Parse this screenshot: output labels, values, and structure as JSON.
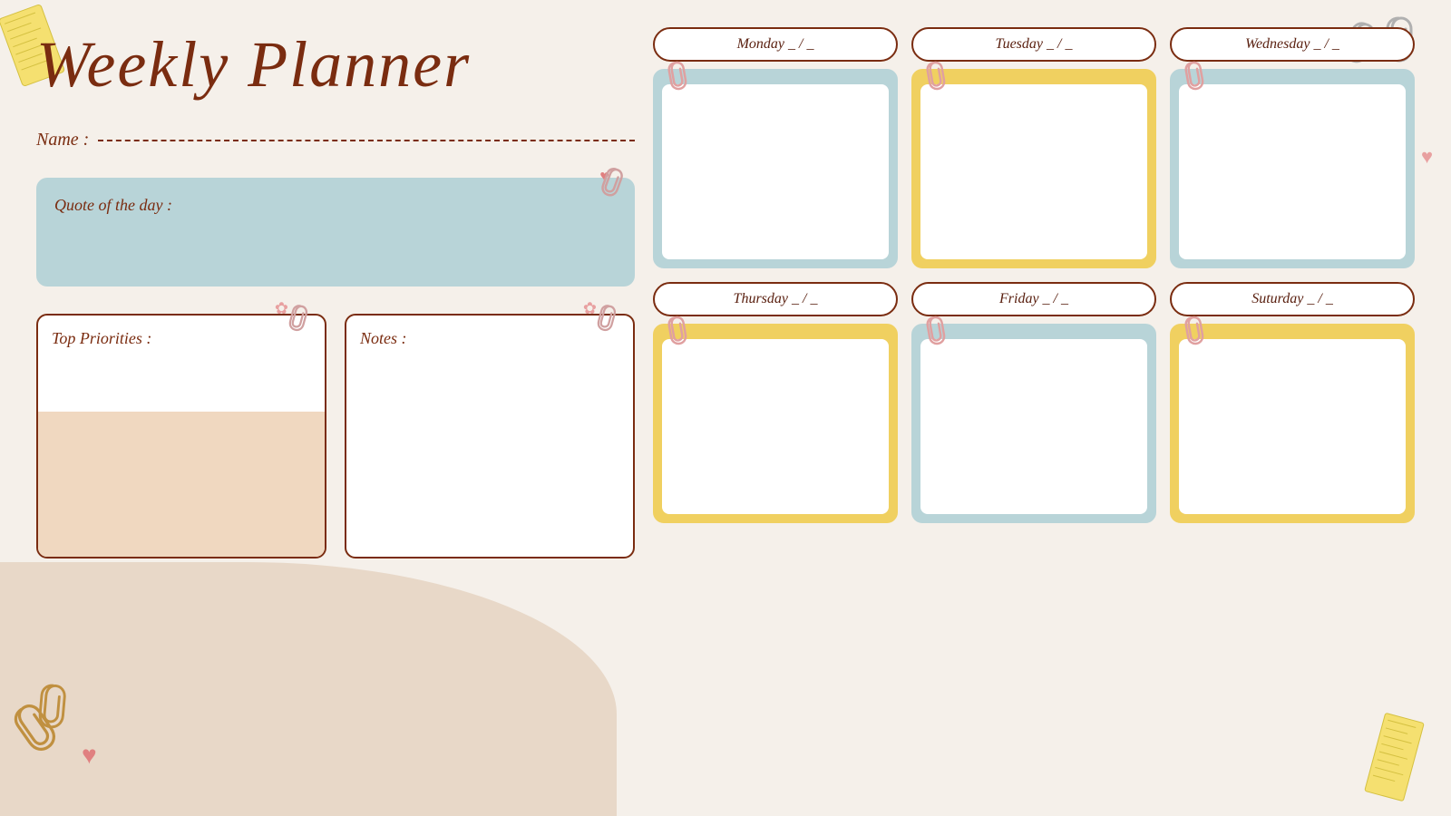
{
  "title": "Weekly Planner",
  "name_label": "Name :",
  "quote_label": "Quote of the day :",
  "priorities_label": "Top Priorities :",
  "notes_label": "Notes :",
  "days": [
    {
      "id": "monday",
      "label": "Monday _ / _",
      "color": "blue"
    },
    {
      "id": "tuesday",
      "label": "Tuesday _ / _",
      "color": "yellow"
    },
    {
      "id": "wednesday",
      "label": "Wednesday _ / _",
      "color": "blue"
    },
    {
      "id": "thursday",
      "label": "Thursday _ / _",
      "color": "yellow"
    },
    {
      "id": "friday",
      "label": "Friday _ / _",
      "color": "blue"
    },
    {
      "id": "saturday",
      "label": "Suturday _ / _",
      "color": "yellow"
    }
  ],
  "accent_color": "#7a2c10",
  "blue_card": "#b8d4d8",
  "yellow_card": "#f0d060"
}
